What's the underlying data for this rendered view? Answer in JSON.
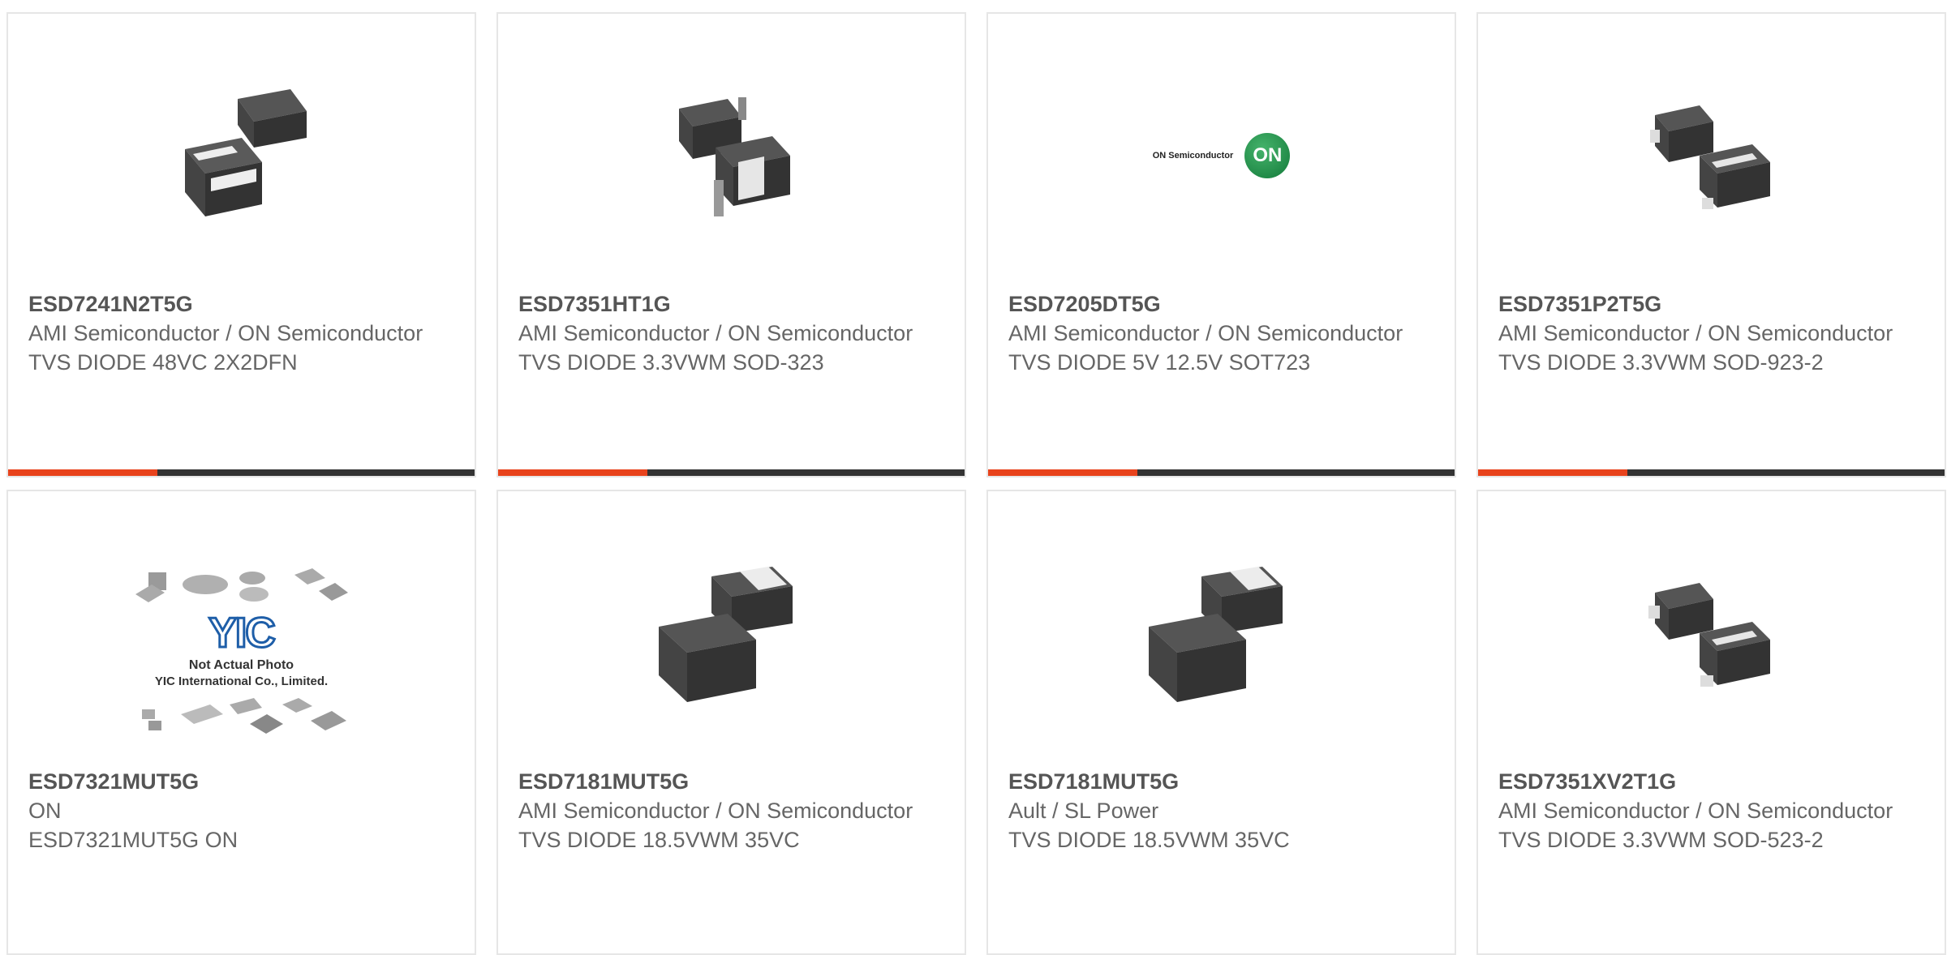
{
  "colors": {
    "accent": "#e8431c",
    "bar_dark": "#333333",
    "border": "#e6e6e6"
  },
  "products": [
    {
      "part": "ESD7241N2T5G",
      "manufacturer": "AMI Semiconductor / ON Semiconductor",
      "description": "TVS DIODE 48VC 2X2DFN",
      "image": "dfn-package-icon",
      "progress": 0.32
    },
    {
      "part": "ESD7351HT1G",
      "manufacturer": "AMI Semiconductor / ON Semiconductor",
      "description": "TVS DIODE 3.3VWM SOD-323",
      "image": "sod-package-icon",
      "progress": 0.32
    },
    {
      "part": "ESD7205DT5G",
      "manufacturer": "AMI Semiconductor / ON Semiconductor",
      "description": "TVS DIODE 5V 12.5V SOT723",
      "image": "on-semi-logo",
      "logo_text": "ON Semiconductor",
      "logo_mark": "ON",
      "progress": 0.32
    },
    {
      "part": "ESD7351P2T5G",
      "manufacturer": "AMI Semiconductor / ON Semiconductor",
      "description": "TVS DIODE 3.3VWM SOD-923-2",
      "image": "sod-package-icon",
      "progress": 0.32
    },
    {
      "part": "ESD7321MUT5G",
      "manufacturer": "ON",
      "description": "ESD7321MUT5G ON",
      "image": "placeholder-photo",
      "photo_line1": "Not Actual Photo",
      "photo_line2": "YIC International Co., Limited.",
      "photo_logo": "YIC"
    },
    {
      "part": "ESD7181MUT5G",
      "manufacturer": "AMI Semiconductor / ON Semiconductor",
      "description": "TVS DIODE 18.5VWM 35VC",
      "image": "dfn-package-icon"
    },
    {
      "part": "ESD7181MUT5G",
      "manufacturer": "Ault / SL Power",
      "description": "TVS DIODE 18.5VWM 35VC",
      "image": "dfn-package-icon"
    },
    {
      "part": "ESD7351XV2T1G",
      "manufacturer": "AMI Semiconductor / ON Semiconductor",
      "description": "TVS DIODE 3.3VWM SOD-523-2",
      "image": "sod-package-icon"
    }
  ]
}
